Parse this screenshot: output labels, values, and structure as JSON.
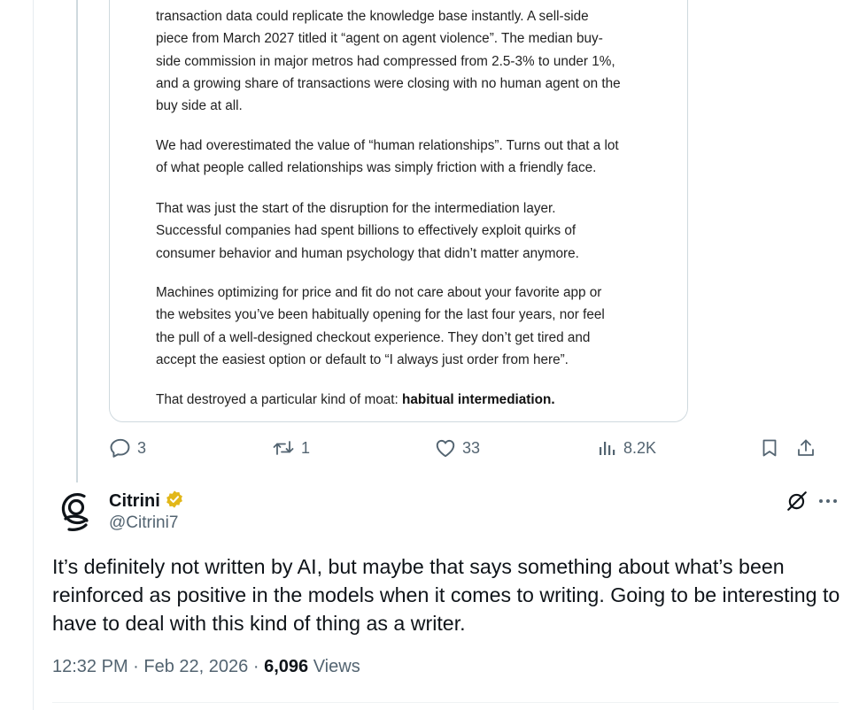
{
  "quoted_post": {
    "paragraphs": [
      {
        "lines": [
          "transaction data could replicate the knowledge base instantly. A sell-side",
          "piece from March 2027 titled it “agent on agent violence”. The median buy-",
          "side commission in major metros had compressed from 2.5-3% to under 1%,",
          "and a growing share of transactions were closing with no human agent on the",
          "buy side at all."
        ]
      },
      {
        "lines": [
          "We had overestimated the value of “human relationships”. Turns out that a lot",
          "of what people called relationships was simply friction with a friendly face."
        ]
      },
      {
        "lines": [
          "That was just the start of the disruption for the intermediation layer.",
          "Successful companies had spent billions to effectively exploit quirks of",
          "consumer behavior and human psychology that didn’t matter anymore."
        ]
      },
      {
        "lines": [
          "Machines optimizing for price and fit do not care about your favorite app or",
          "the websites you’ve been habitually opening for the last four years, nor feel",
          "the pull of a well-designed checkout experience. They don’t get tired and",
          "accept the easiest option or default to “I always just order from here”."
        ]
      }
    ],
    "final_line_prefix": "That destroyed a particular kind of moat: ",
    "final_line_bold": "habitual intermediation."
  },
  "actions": {
    "replies": "3",
    "reposts": "1",
    "likes": "33",
    "views": "8.2K"
  },
  "reply": {
    "display_name": "Citrini",
    "handle": "@Citrini7",
    "verified": true,
    "text": "It’s definitely not written by AI, but maybe that says something about what’s been reinforced as positive in the models when it comes to writing. Going to be interesting to have to deal with this kind of thing as a writer.",
    "time": "12:32 PM",
    "separator": "·",
    "date": "Feb 22, 2026",
    "view_count": "6,096",
    "views_label": "Views"
  },
  "colors": {
    "text_primary": "#0f1419",
    "text_secondary": "#536471",
    "border": "#cfd9de",
    "verified_badge": "#e2b719"
  },
  "icons": [
    "reply-icon",
    "repost-icon",
    "like-icon",
    "views-icon",
    "bookmark-icon",
    "share-icon",
    "verified-badge-icon",
    "grok-icon",
    "more-icon",
    "avatar-logo-icon"
  ]
}
